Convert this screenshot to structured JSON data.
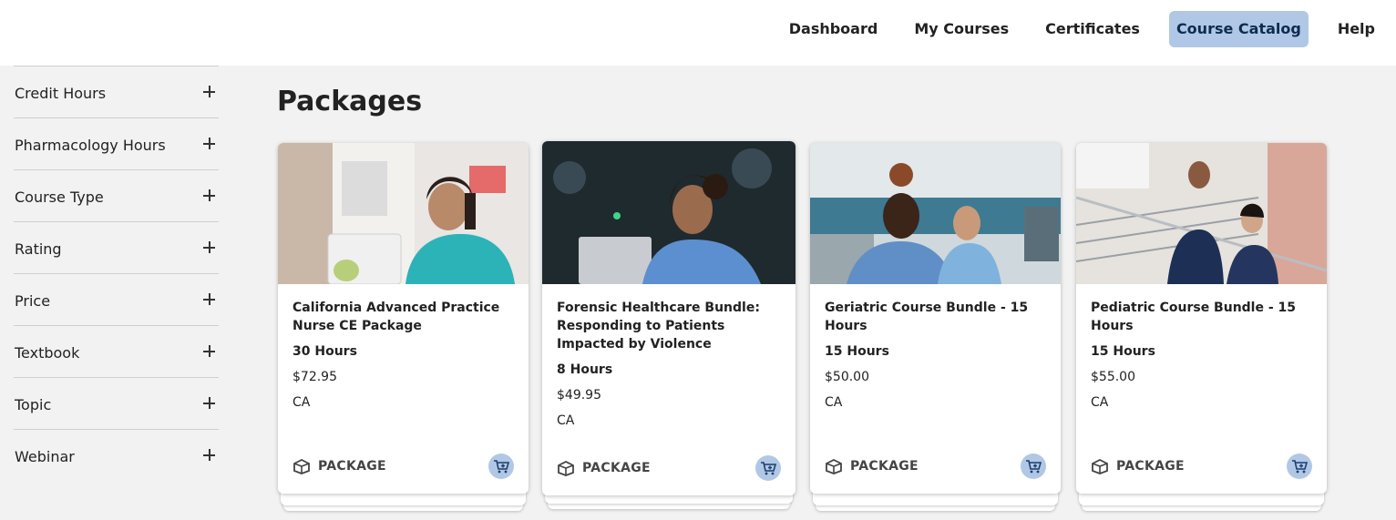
{
  "nav": {
    "items": [
      {
        "label": "Dashboard",
        "active": false
      },
      {
        "label": "My Courses",
        "active": false
      },
      {
        "label": "Certificates",
        "active": false
      },
      {
        "label": "Course Catalog",
        "active": true
      },
      {
        "label": "Help",
        "active": false
      }
    ]
  },
  "filters": [
    {
      "label": "Credit Hours"
    },
    {
      "label": "Pharmacology Hours"
    },
    {
      "label": "Course Type"
    },
    {
      "label": "Rating"
    },
    {
      "label": "Price"
    },
    {
      "label": "Textbook"
    },
    {
      "label": "Topic"
    },
    {
      "label": "Webinar"
    }
  ],
  "main": {
    "title": "Packages"
  },
  "cards": [
    {
      "title": "California Advanced Practice Nurse CE Package",
      "hours": "30 Hours",
      "price": "$72.95",
      "state": "CA",
      "type_label": "PACKAGE"
    },
    {
      "title": "Forensic Healthcare Bundle: Responding to Patients Impacted by Violence",
      "hours": "8 Hours",
      "price": "$49.95",
      "state": "CA",
      "type_label": "PACKAGE"
    },
    {
      "title": "Geriatric Course Bundle - 15 Hours",
      "hours": "15 Hours",
      "price": "$50.00",
      "state": "CA",
      "type_label": "PACKAGE"
    },
    {
      "title": "Pediatric Course Bundle - 15 Hours",
      "hours": "15 Hours",
      "price": "$55.00",
      "state": "CA",
      "type_label": "PACKAGE"
    }
  ],
  "colors": {
    "accent": "#b0c8e6",
    "background": "#f2f2f2",
    "header_bg": "#ffffff"
  },
  "icons": {
    "package": "package-icon",
    "cart": "cart-plus-icon",
    "expand": "plus-icon"
  }
}
